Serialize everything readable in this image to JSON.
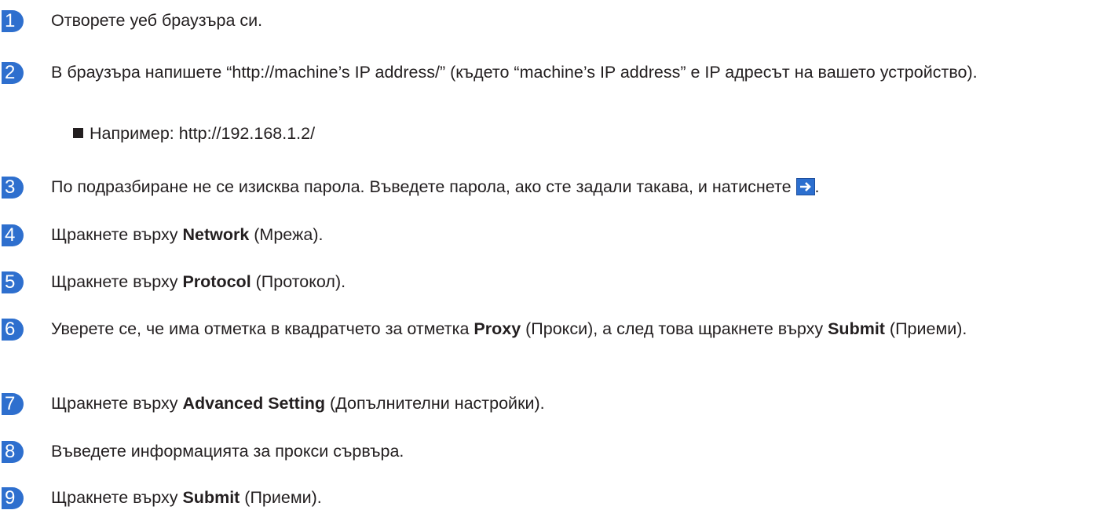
{
  "steps": [
    {
      "num": "1",
      "text": "Отворете уеб браузъра си."
    },
    {
      "num": "2",
      "text": "В браузъра напишете “http://machine’s IP address/” (където “machine’s IP address” е IP адресът на вашето устройство).",
      "sub": "Например: http://192.168.1.2/"
    },
    {
      "num": "3",
      "text": "По подразбиране не се изисква парола. Въведете парола, ако сте задали такава, и натиснете",
      "tail": "."
    },
    {
      "num": "4",
      "pre": "Щракнете върху ",
      "bold": "Network",
      "post": " (Мрежа)."
    },
    {
      "num": "5",
      "pre": "Щракнете върху ",
      "bold": "Protocol",
      "post": " (Протокол)."
    },
    {
      "num": "6",
      "pre": "Уверете се, че има отметка в квадратчето за отметка ",
      "bold": "Proxy",
      "mid": " (Прокси), а след това щракнете върху ",
      "bold2": "Submit",
      "post": " (Приеми)."
    },
    {
      "num": "7",
      "pre": "Щракнете върху ",
      "bold": "Advanced Setting",
      "post": " (Допълнителни настройки)."
    },
    {
      "num": "8",
      "text": "Въведете информацията за прокси сървъра."
    },
    {
      "num": "9",
      "pre": "Щракнете върху ",
      "bold": "Submit",
      "post": " (Приеми)."
    }
  ],
  "icons": {
    "go": "arrow-right-icon"
  },
  "colors": {
    "badge": "#2e6fce",
    "text": "#231f20"
  }
}
